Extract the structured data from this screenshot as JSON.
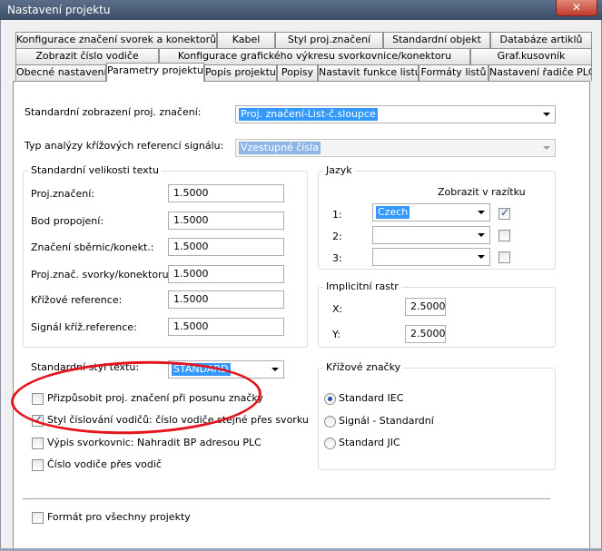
{
  "window": {
    "title": "Nastavení projektu",
    "close_glyph": "✕"
  },
  "tabs": {
    "row1": [
      "Konfigurace značení svorek a konektorů",
      "Kabel",
      "Styl proj.značení",
      "Standardní objekt",
      "Databáze artiklů"
    ],
    "row2": [
      "Zobrazit číslo vodiče",
      "Konfigurace grafického výkresu svorkovnice/konektoru",
      "Graf.kusovník"
    ],
    "row3": [
      "Obecné nastavení",
      "Parametry projektu",
      "Popis projektu",
      "Popisy",
      "Nastavit funkce listu",
      "Formáty listů",
      "Nastavení řadiče PLC"
    ],
    "active": "Parametry projektu"
  },
  "designation": {
    "label": "Standardní zobrazení proj. značení:",
    "value": "Proj. značení-List-č.sloupce"
  },
  "crossref_type": {
    "label": "Typ analýzy křížových referencí signálu:",
    "value": "Vzestupné čísla"
  },
  "text_sizes": {
    "title": "Standardní velikosti textu",
    "rows": [
      {
        "label": "Proj.značení:",
        "value": "1.5000"
      },
      {
        "label": "Bod propojení:",
        "value": "1.5000"
      },
      {
        "label": "Značení sběrnic/konekt.:",
        "value": "1.5000"
      },
      {
        "label": "Proj.znač. svorky/konektoru:",
        "value": "1.5000"
      },
      {
        "label": "Křížové reference:",
        "value": "1.5000"
      },
      {
        "label": "Signál kříž.reference:",
        "value": "1.5000"
      }
    ]
  },
  "language": {
    "title": "Jazyk",
    "column_header": "Zobrazit v razítku",
    "rows": [
      {
        "label": "1:",
        "value": "Czech",
        "checked": true
      },
      {
        "label": "2:",
        "value": "",
        "checked": false
      },
      {
        "label": "3:",
        "value": "",
        "checked": false
      }
    ]
  },
  "raster": {
    "title": "Implicitní rastr",
    "x_label": "X:",
    "x_value": "2.5000",
    "y_label": "Y:",
    "y_value": "2.5000"
  },
  "text_style": {
    "label": "Standardní styl textu:",
    "value": "STANDARD"
  },
  "options": [
    {
      "label": "Přizpůsobit proj. značení při posunu značky",
      "checked": false
    },
    {
      "label": "Styl číslování vodičů: číslo vodiče stejné přes svorku",
      "checked": true
    },
    {
      "label": "Výpis svorkovnic: Nahradit BP adresou PLC",
      "checked": false
    },
    {
      "label": "Číslo vodiče přes vodič",
      "checked": false
    }
  ],
  "crossref_symbols": {
    "title": "Křížové značky",
    "options": [
      {
        "label": "Standard IEC",
        "checked": true
      },
      {
        "label": "Signál - Standardní",
        "checked": false
      },
      {
        "label": "Standard JIC",
        "checked": false
      }
    ]
  },
  "all_projects": {
    "label": "Formát pro všechny projekty",
    "checked": false
  },
  "colors": {
    "annotation": "#e4151c",
    "selection": "#3399ff",
    "titlebar": "#4a5a73"
  }
}
